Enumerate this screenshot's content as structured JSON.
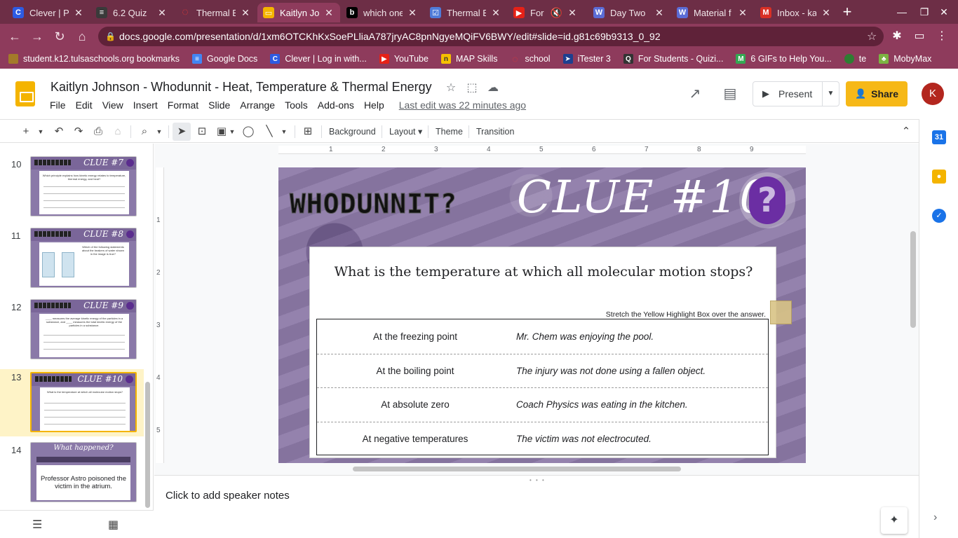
{
  "browser": {
    "tabs": [
      {
        "title": "Clever | Po",
        "icon": "clever-icon",
        "color": "#2d5be3",
        "glyph": "C"
      },
      {
        "title": "6.2 Quiz",
        "icon": "quiz-icon",
        "color": "#3a3a3a",
        "glyph": "≡"
      },
      {
        "title": "Thermal E",
        "icon": "ring-icon",
        "color": "#e53935",
        "glyph": "◌"
      },
      {
        "title": "Kaitlyn Jo",
        "icon": "slides-icon",
        "color": "#f4b400",
        "glyph": "▭"
      },
      {
        "title": "which one",
        "icon": "brainly-icon",
        "color": "#000000",
        "glyph": "b"
      },
      {
        "title": "Thermal E",
        "icon": "forms-icon",
        "color": "#4f7bd9",
        "glyph": "☑"
      },
      {
        "title": "For Ki",
        "icon": "youtube-icon",
        "color": "#e62117",
        "glyph": "▶"
      },
      {
        "title": "Day Two",
        "icon": "wp-icon",
        "color": "#5b6cd6",
        "glyph": "W"
      },
      {
        "title": "Material f",
        "icon": "wp-icon",
        "color": "#5b6cd6",
        "glyph": "W"
      },
      {
        "title": "Inbox - ka",
        "icon": "gmail-icon",
        "color": "#d93025",
        "glyph": "M"
      }
    ],
    "url": "docs.google.com/presentation/d/1xm6OTCKhKxSoePLliaA787jryAC8pnNgyeMQiFV6BWY/edit#slide=id.g81c69b9313_0_92",
    "bookmarks": [
      {
        "label": "student.k12.tulsaschools.org bookmarks",
        "color": "#a37a2a",
        "glyph": ""
      },
      {
        "label": "Google Docs",
        "color": "#4285f4",
        "glyph": "≡"
      },
      {
        "label": "Clever | Log in with...",
        "color": "#2d5be3",
        "glyph": "C"
      },
      {
        "label": "YouTube",
        "color": "#e62117",
        "glyph": "▶"
      },
      {
        "label": "MAP Skills",
        "color": "#f6c000",
        "glyph": "n"
      },
      {
        "label": "school",
        "color": "#e53935",
        "glyph": "◌"
      },
      {
        "label": "iTester 3",
        "color": "#1d3f8f",
        "glyph": "➤"
      },
      {
        "label": "For Students - Quizi...",
        "color": "#333333",
        "glyph": "Q"
      },
      {
        "label": "6 GIFs to Help You...",
        "color": "#34a853",
        "glyph": "M"
      },
      {
        "label": "te",
        "color": "#2e7d32",
        "glyph": "●"
      },
      {
        "label": "MobyMax",
        "color": "#7cb342",
        "glyph": "♣"
      }
    ]
  },
  "doc": {
    "title": "Kaitlyn Johnson - Whodunnit - Heat, Temperature & Thermal Energy",
    "menus": [
      "File",
      "Edit",
      "View",
      "Insert",
      "Format",
      "Slide",
      "Arrange",
      "Tools",
      "Add-ons",
      "Help"
    ],
    "last_edit": "Last edit was 22 minutes ago",
    "present_label": "Present",
    "share_label": "Share",
    "avatar_letter": "K",
    "toolbar": {
      "background": "Background",
      "layout": "Layout",
      "theme": "Theme",
      "transition": "Transition"
    }
  },
  "filmstrip": [
    {
      "num": "10",
      "title": "CLUE #7",
      "caption": "Which principle explains how kinetic energy relates to temperature, thermal energy, and heat?"
    },
    {
      "num": "11",
      "title": "CLUE #8",
      "caption": "Which of the following statements about the beakers of water shown in the image is true?"
    },
    {
      "num": "12",
      "title": "CLUE #9",
      "caption": "____ measures the average kinetic energy of the particles in a substance, and ____ measures the total kinetic energy of the particles in a substance."
    },
    {
      "num": "13",
      "title": "CLUE #10",
      "caption": "What is the temperature at which all molecular motion stops?"
    },
    {
      "num": "14",
      "title": "What happened?",
      "caption": "Professor Astro poisoned the victim in the atrium."
    }
  ],
  "slide": {
    "whodunnit": "WHODUNNIT?",
    "clue_title": "CLUE #10",
    "badge": "?",
    "question": "What is the temperature at which all molecular motion stops?",
    "instruction": "Stretch the Yellow Highlight Box over the answer.",
    "rows": [
      {
        "answer": "At the freezing point",
        "clue": "Mr. Chem was enjoying the pool."
      },
      {
        "answer": "At the boiling point",
        "clue": "The injury was not done using a fallen object."
      },
      {
        "answer": "At absolute zero",
        "clue": "Coach Physics was eating in the kitchen."
      },
      {
        "answer": "At negative temperatures",
        "clue": "The victim was not electrocuted."
      }
    ]
  },
  "ruler": {
    "h": [
      "1",
      "2",
      "3",
      "4",
      "5",
      "6",
      "7",
      "8",
      "9"
    ],
    "v": [
      "1",
      "2",
      "3",
      "4",
      "5"
    ]
  },
  "notes_placeholder": "Click to add speaker notes"
}
